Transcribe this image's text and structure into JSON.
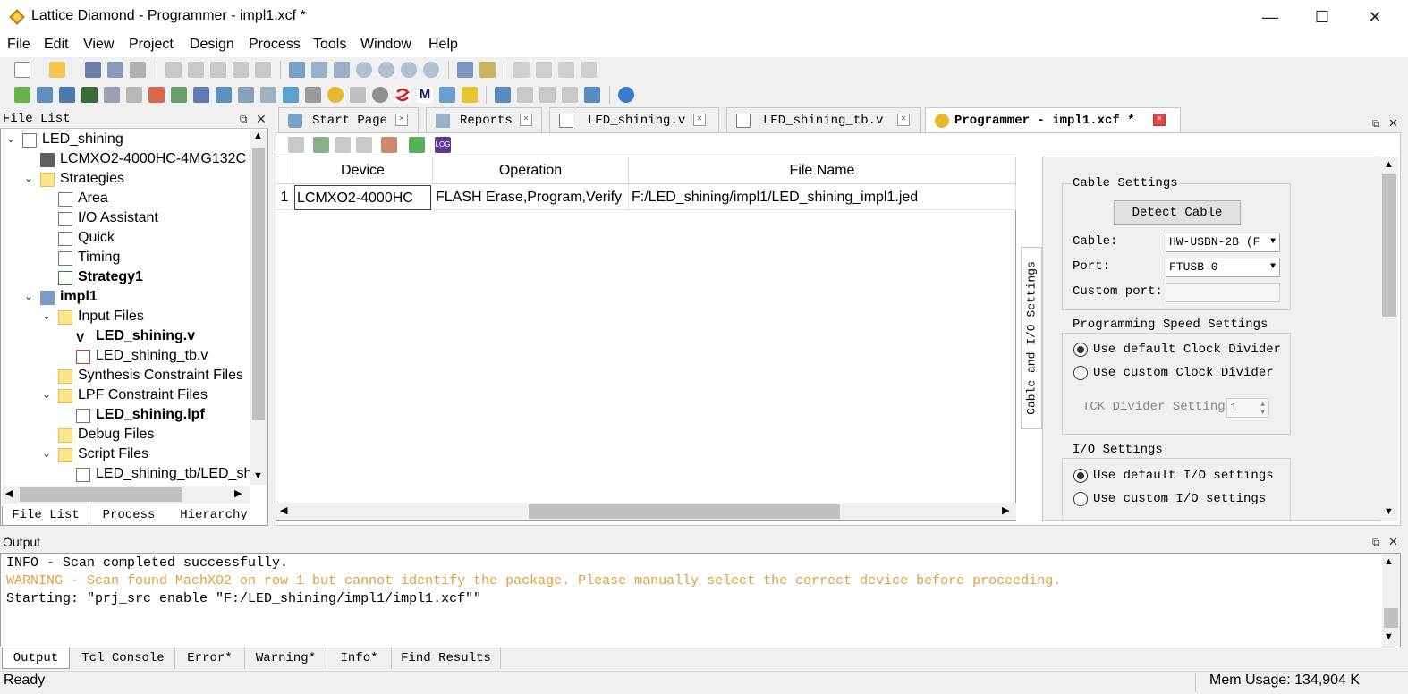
{
  "window": {
    "title": "Lattice Diamond - Programmer - impl1.xcf *",
    "minimize": "—",
    "maximize": "☐",
    "close": "✕"
  },
  "menu": [
    "File",
    "Edit",
    "View",
    "Project",
    "Design",
    "Process",
    "Tools",
    "Window",
    "Help"
  ],
  "file_list": {
    "title": "File List",
    "tree": [
      {
        "label": "LED_shining",
        "bold": false
      },
      {
        "label": "LCMXO2-4000HC-4MG132C",
        "bold": false
      },
      {
        "label": "Strategies",
        "bold": false
      },
      {
        "label": "Area",
        "bold": false
      },
      {
        "label": "I/O Assistant",
        "bold": false
      },
      {
        "label": "Quick",
        "bold": false
      },
      {
        "label": "Timing",
        "bold": false
      },
      {
        "label": "Strategy1",
        "bold": true
      },
      {
        "label": "impl1",
        "bold": true
      },
      {
        "label": "Input Files",
        "bold": false
      },
      {
        "label": "LED_shining.v",
        "bold": true
      },
      {
        "label": "LED_shining_tb.v",
        "bold": false
      },
      {
        "label": "Synthesis Constraint Files",
        "bold": false
      },
      {
        "label": "LPF Constraint Files",
        "bold": false
      },
      {
        "label": "LED_shining.lpf",
        "bold": true
      },
      {
        "label": "Debug Files",
        "bold": false
      },
      {
        "label": "Script Files",
        "bold": false
      },
      {
        "label": "LED_shining_tb/LED_shi",
        "bold": false
      }
    ],
    "tabs": [
      "File List",
      "Process",
      "Hierarchy"
    ]
  },
  "doc_tabs": [
    {
      "label": "Start Page"
    },
    {
      "label": "Reports"
    },
    {
      "label": "LED_shining.v"
    },
    {
      "label": "LED_shining_tb.v"
    },
    {
      "label": "Programmer - impl1.xcf *"
    }
  ],
  "grid": {
    "headers": [
      "Device",
      "Operation",
      "File Name"
    ],
    "rows": [
      {
        "num": "1",
        "device": "LCMXO2-4000HC",
        "operation": "FLASH Erase,Program,Verify",
        "file": "F:/LED_shining/impl1/LED_shining_impl1.jed"
      }
    ]
  },
  "side_tab": "Cable and I/O Settings",
  "settings": {
    "cable_group": "Cable Settings",
    "detect_button": "Detect Cable",
    "cable_label": "Cable:",
    "cable_value": "HW-USBN-2B (F",
    "port_label": "Port:",
    "port_value": "FTUSB-0",
    "custom_port_label": "Custom port:",
    "speed_group": "Programming Speed Settings",
    "speed_default": "Use default Clock Divider",
    "speed_custom": "Use custom Clock Divider",
    "tck_label": "TCK Divider Setting",
    "tck_value": "1",
    "io_group": "I/O Settings",
    "io_default": "Use default I/O settings",
    "io_custom": "Use custom I/O settings"
  },
  "output": {
    "title": "Output",
    "lines": [
      {
        "text": "INFO - Scan completed successfully.",
        "color": "#000000"
      },
      {
        "text": "WARNING - Scan found MachXO2 on row 1 but cannot identify the package. Please manually select the correct device before proceeding.",
        "color": "#e0a040"
      },
      {
        "text": "Starting: \"prj_src enable \"F:/LED_shining/impl1/impl1.xcf\"\"",
        "color": "#000000"
      }
    ],
    "tabs": [
      "Output",
      "Tcl Console",
      "Error*",
      "Warning*",
      "Info*",
      "Find Results"
    ]
  },
  "status": {
    "text": "Ready",
    "mem": "Mem Usage:  134,904 K"
  }
}
